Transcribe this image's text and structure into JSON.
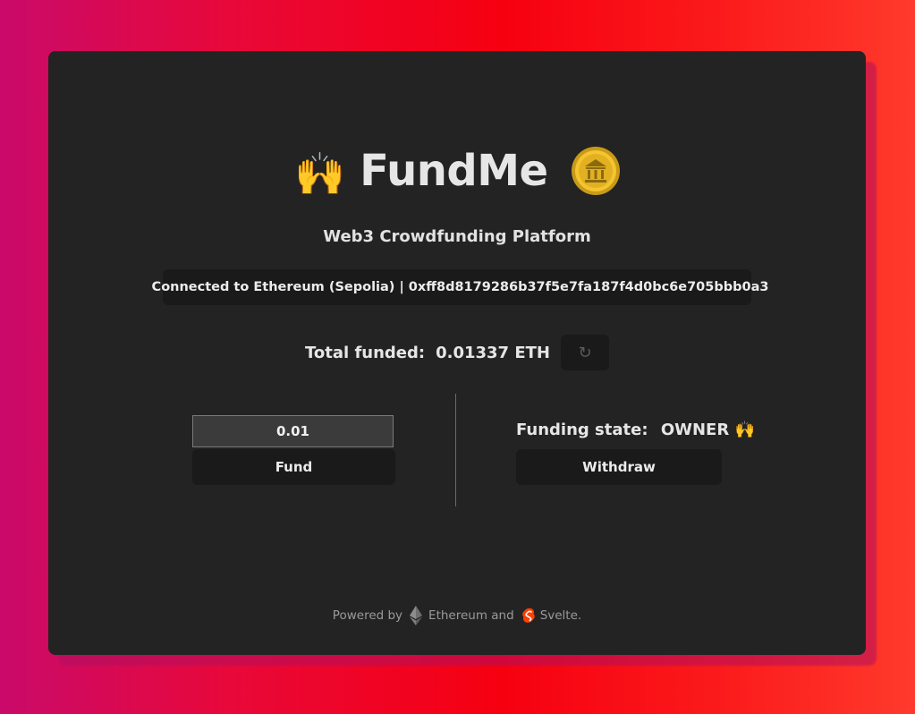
{
  "header": {
    "title": "FundMe",
    "title_emoji": "🙌",
    "subtitle": "Web3 Crowdfunding Platform"
  },
  "status": {
    "text": "Connected to Ethereum (Sepolia) | 0xff8d8179286b37f5e7fa187f4d0bc6e705bbb0a3",
    "indicator_color": "#2bb52b"
  },
  "total": {
    "label": "Total funded:",
    "value": "0.01337 ETH",
    "refresh_label": "↻"
  },
  "fund": {
    "amount_value": "0.01",
    "button_label": "Fund"
  },
  "owner": {
    "state_label": "Funding state:",
    "state_value": "OWNER 🙌",
    "withdraw_label": "Withdraw"
  },
  "footer": {
    "powered_by": "Powered by",
    "ethereum_label": "Ethereum and",
    "svelte_label": "Svelte."
  },
  "colors": {
    "card_background": "#232323",
    "button_background": "#1a1a1a",
    "svelte_brand": "#ff3e00"
  }
}
